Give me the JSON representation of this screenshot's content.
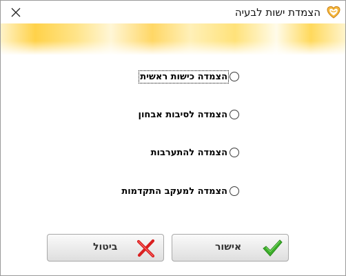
{
  "window": {
    "title": "הצמדת ישות לבעיה"
  },
  "options": [
    {
      "label": "הצמדה כישות ראשית",
      "selected": false,
      "focused": true
    },
    {
      "label": "הצמדה לסיבות אבחון",
      "selected": false,
      "focused": false
    },
    {
      "label": "הצמדה להתערבות",
      "selected": false,
      "focused": false
    },
    {
      "label": "הצמדה למעקב התקדמות",
      "selected": false,
      "focused": false
    }
  ],
  "buttons": {
    "cancel_label": "ביטול",
    "confirm_label": "אישור"
  },
  "colors": {
    "accent_check": "#3cae2a",
    "accent_cross": "#d92020",
    "banner_yellow": "#ffd24a"
  },
  "icons": {
    "close": "close-icon",
    "app": "heart-icon",
    "cancel": "red-x-icon",
    "confirm": "green-check-icon"
  }
}
